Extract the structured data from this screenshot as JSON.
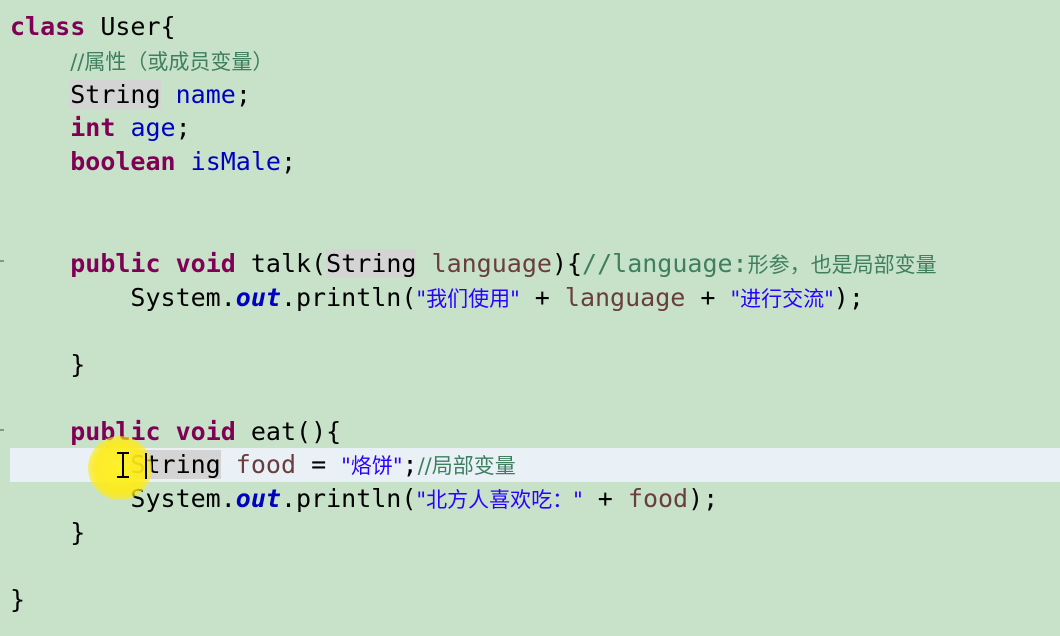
{
  "colors": {
    "background": "#c7e2c9",
    "current_line": "#e9f1f7",
    "keyword": "#7f0055",
    "field": "#0000c0",
    "string": "#2a00ff",
    "comment": "#3f7f5f",
    "local_variable": "#6a3e3e",
    "cursor_highlight": "#ffeb14"
  },
  "code": {
    "l1": {
      "kw": "class",
      "rest": " User{"
    },
    "l2": {
      "comment": "//属性（或成员变量）"
    },
    "l3": {
      "type": "String",
      "field": "name",
      "end": ";"
    },
    "l4": {
      "kw": "int",
      "field": "age",
      "end": ";"
    },
    "l5": {
      "kw": "boolean",
      "field": "isMale",
      "end": ";"
    },
    "l8": {
      "kw1": "public",
      "kw2": "void",
      "method": "talk(",
      "param_type": "String",
      "param": "language",
      "close": "){",
      "comment_code": "//language:",
      "comment_zh": "形参，也是局部变量"
    },
    "l9": {
      "sys": "System.",
      "out": "out",
      "println": ".println(",
      "str1": "\"我们使用\"",
      "plus1": " + ",
      "var": "language",
      "plus2": " + ",
      "str2": "\"进行交流\"",
      "end": ");"
    },
    "l11": {
      "brace": "}"
    },
    "l13": {
      "kw1": "public",
      "kw2": "void",
      "method": "eat(){"
    },
    "l14": {
      "type": "String",
      "var": "food",
      "eq": " = ",
      "str": "\"烙饼\"",
      "semi": ";",
      "comment": "//局部变量"
    },
    "l15": {
      "sys": "System.",
      "out": "out",
      "println": ".println(",
      "str": "\"北方人喜欢吃：\"",
      "plus": " + ",
      "var": "food",
      "end": ");"
    },
    "l16": {
      "brace": "}"
    },
    "l18": {
      "brace": "}"
    }
  }
}
